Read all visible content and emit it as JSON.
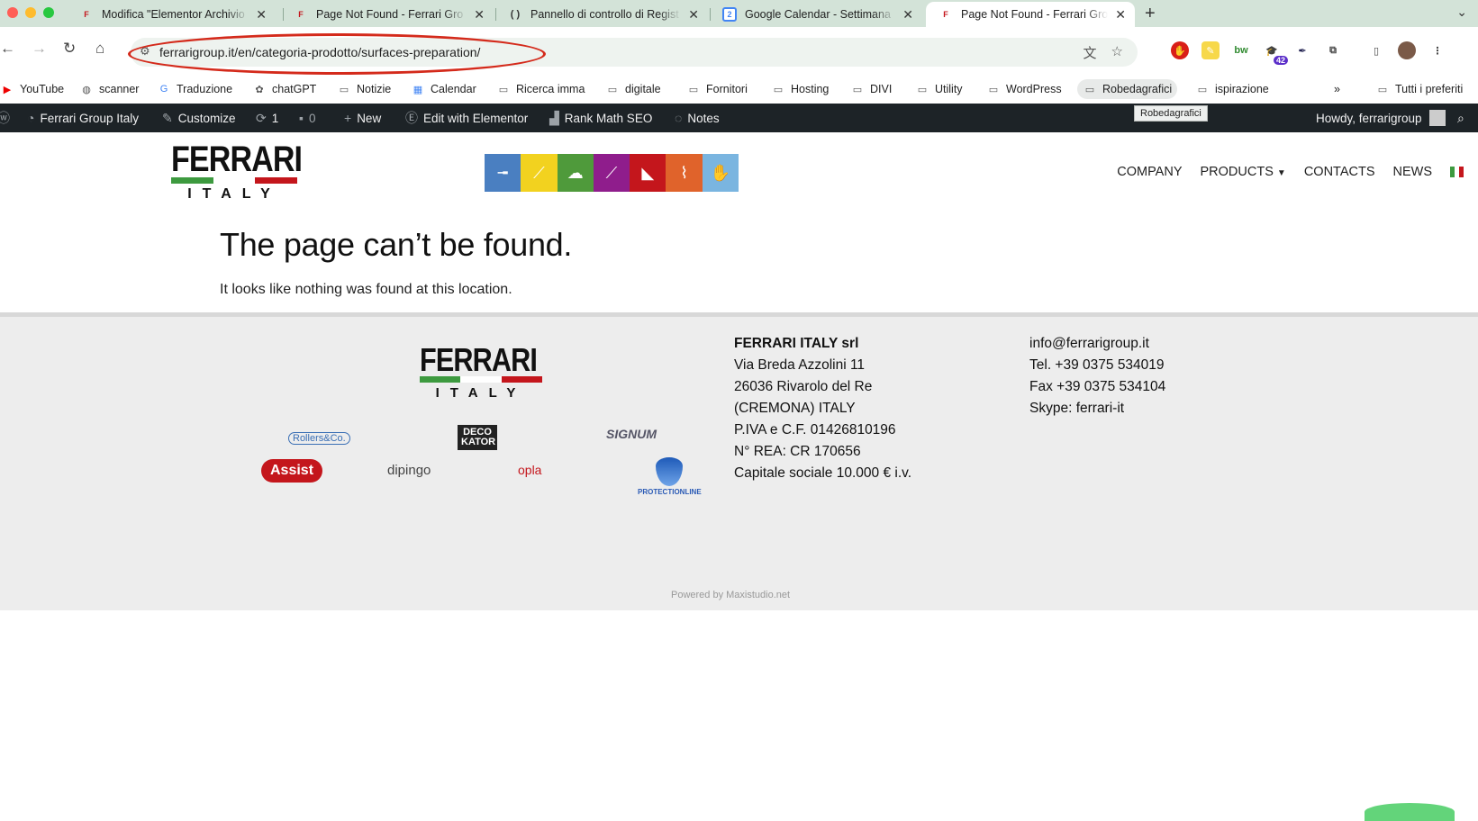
{
  "browser": {
    "tabs": [
      {
        "title": "Modifica \"Elementor Archivio",
        "favicon": "F"
      },
      {
        "title": "Page Not Found - Ferrari Gro",
        "favicon": "F"
      },
      {
        "title": "Pannello di controllo di Regist",
        "favicon": "( )"
      },
      {
        "title": "Google Calendar - Settimana",
        "favicon": "2"
      },
      {
        "title": "Page Not Found - Ferrari Gro",
        "favicon": "F"
      }
    ],
    "url": "ferrarigroup.it/en/categoria-prodotto/surfaces-preparation/",
    "extension_badge": "42"
  },
  "bookmarks": {
    "items": [
      "YouTube",
      "scanner",
      "Traduzione",
      "chatGPT",
      "Notizie",
      "Calendar",
      "Ricerca imma",
      "digitale",
      "Fornitori",
      "Hosting",
      "DIVI",
      "Utility",
      "WordPress",
      "Robedagrafici",
      "ispirazione"
    ],
    "overflow": "»",
    "all_bookmarks": "Tutti i preferiti",
    "tooltip": "Robedagrafici"
  },
  "wpbar": {
    "site": "Ferrari Group Italy",
    "customize": "Customize",
    "updates": "1",
    "comments": "0",
    "new": "New",
    "elementor": "Edit with Elementor",
    "rankmath": "Rank Math SEO",
    "notes": "Notes",
    "howdy": "Howdy, ferrarigroup"
  },
  "site": {
    "logo_word": "FERRARI",
    "logo_country": "ITALY",
    "nav": [
      "COMPANY",
      "PRODUCTS",
      "CONTACTS",
      "NEWS"
    ]
  },
  "content": {
    "title": "The page can’t be found.",
    "text": "It looks like nothing was found at this location."
  },
  "footer": {
    "brands": [
      "Rollers&Co.",
      "DECO KATOR",
      "SIGNUM",
      "Assist",
      "dipingo",
      "opla",
      "PROTECTIONLINE"
    ],
    "company": "FERRARI ITALY srl",
    "address": [
      "Via Breda Azzolini 11",
      "26036 Rivarolo del Re",
      "(CREMONA) ITALY",
      "P.IVA e C.F. 01426810196",
      "N° REA: CR 170656",
      "Capitale sociale 10.000 € i.v."
    ],
    "contacts": [
      "info@ferrarigroup.it",
      "Tel. +39 0375 534019",
      "Fax +39 0375 534104",
      "Skype: ferrari-it"
    ],
    "powered": "Powered by Maxistudio.net"
  },
  "colors": {
    "flag_green": "#3d9a3f",
    "flag_white": "#ffffff",
    "flag_red": "#c4161c",
    "highlight_ellipse": "#d42a1b",
    "wp_bar": "#1d2327",
    "strip": [
      "#4a7fc1",
      "#f2d21f",
      "#4f9a3b",
      "#8f1d8c",
      "#c4161c",
      "#e0632b",
      "#7ab5e0"
    ]
  }
}
